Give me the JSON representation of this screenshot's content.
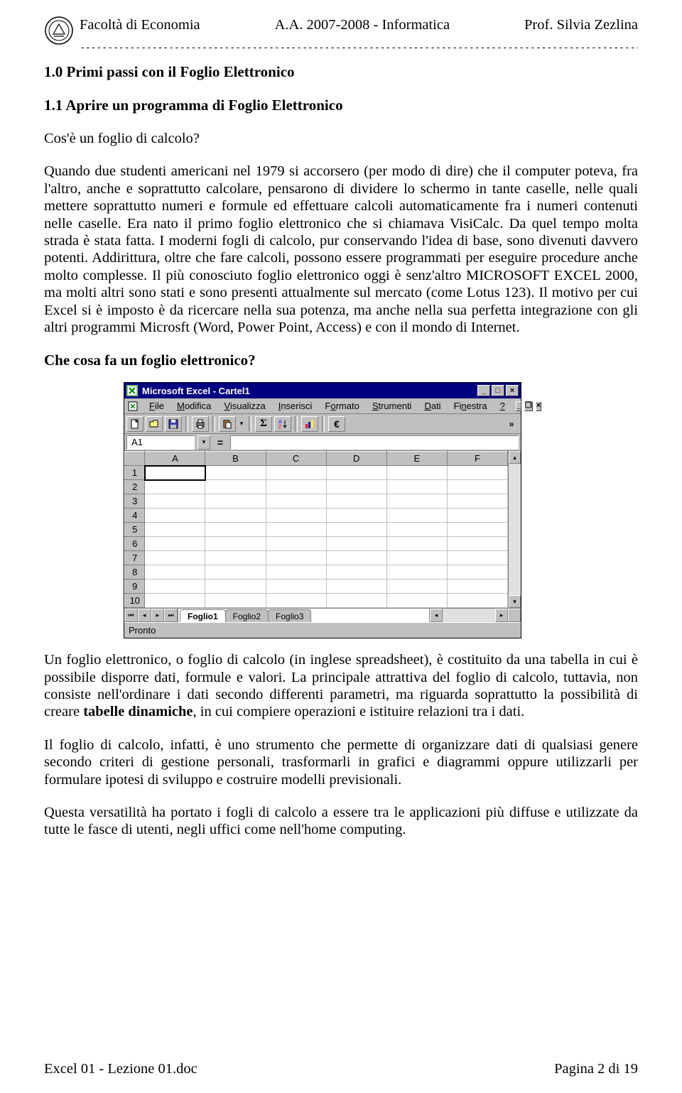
{
  "header": {
    "left": "Facoltà di Economia",
    "center": "A.A. 2007-2008 - Informatica",
    "right": "Prof. Silvia Zezlina"
  },
  "section_num": "1.0 Primi passi con il Foglio Elettronico",
  "subsection_num": "1.1 Aprire un programma di Foglio Elettronico",
  "q1": "Cos'è un foglio di calcolo?",
  "para1": "Quando due studenti americani nel 1979 si accorsero (per modo di dire) che il computer poteva, fra l'altro, anche e soprattutto calcolare, pensarono di dividere lo schermo in tante caselle, nelle quali mettere soprattutto numeri e formule ed effettuare calcoli automaticamente fra i numeri contenuti nelle caselle. Era nato il primo foglio elettronico che si chiamava VisiCalc. Da quel tempo molta strada è stata fatta. I moderni fogli di calcolo, pur conservando l'idea di base, sono divenuti davvero potenti. Addirittura, oltre che fare calcoli, possono essere programmati per eseguire procedure anche molto complesse. Il più conosciuto foglio elettronico oggi è senz'altro MICROSOFT EXCEL 2000, ma molti altri sono stati e sono presenti attualmente sul mercato (come Lotus 123). Il motivo per cui Excel si è imposto è da ricercare nella sua potenza, ma anche nella sua perfetta integrazione con gli altri programmi Microsft (Word, Power Point, Access) e con il mondo di Internet.",
  "q2": "Che cosa fa un foglio elettronico?",
  "para2a": "Un foglio elettronico, o foglio di calcolo (in inglese spreadsheet), è costituito da una tabella in cui è possibile disporre dati, formule e valori. La principale attrattiva del foglio di calcolo, tuttavia, non consiste nell'ordinare i dati secondo differenti parametri, ma riguarda soprattutto la possibilità di creare ",
  "para2b_bold": "tabelle dinamiche",
  "para2c": ", in cui compiere operazioni e istituire relazioni tra i dati.",
  "para3": "Il foglio di calcolo, infatti, è uno strumento che permette di organizzare dati di qualsiasi genere secondo criteri di gestione personali, trasformarli in grafici e diagrammi oppure utilizzarli per formulare ipotesi di sviluppo e costruire modelli previsionali.",
  "para4": "Questa versatilità ha portato i fogli di calcolo a essere tra le applicazioni più diffuse e utilizzate da tutte le fasce di utenti, negli uffici come nell'home computing.",
  "footer": {
    "left": "Excel 01 - Lezione 01.doc",
    "right": "Pagina 2 di 19"
  },
  "excel": {
    "title": "Microsoft Excel - Cartel1",
    "menus": [
      "File",
      "Modifica",
      "Visualizza",
      "Inserisci",
      "Formato",
      "Strumenti",
      "Dati",
      "Finestra",
      "?"
    ],
    "namebox": "A1",
    "columns": [
      "A",
      "B",
      "C",
      "D",
      "E",
      "F"
    ],
    "rows": [
      "1",
      "2",
      "3",
      "4",
      "5",
      "6",
      "7",
      "8",
      "9",
      "10"
    ],
    "tabs": [
      "Foglio1",
      "Foglio2",
      "Foglio3"
    ],
    "active_tab": 0,
    "status": "Pronto",
    "toolbar_icons": [
      "new",
      "open",
      "save",
      "print",
      "paste",
      "sigma",
      "sort",
      "chart",
      "euro"
    ]
  }
}
